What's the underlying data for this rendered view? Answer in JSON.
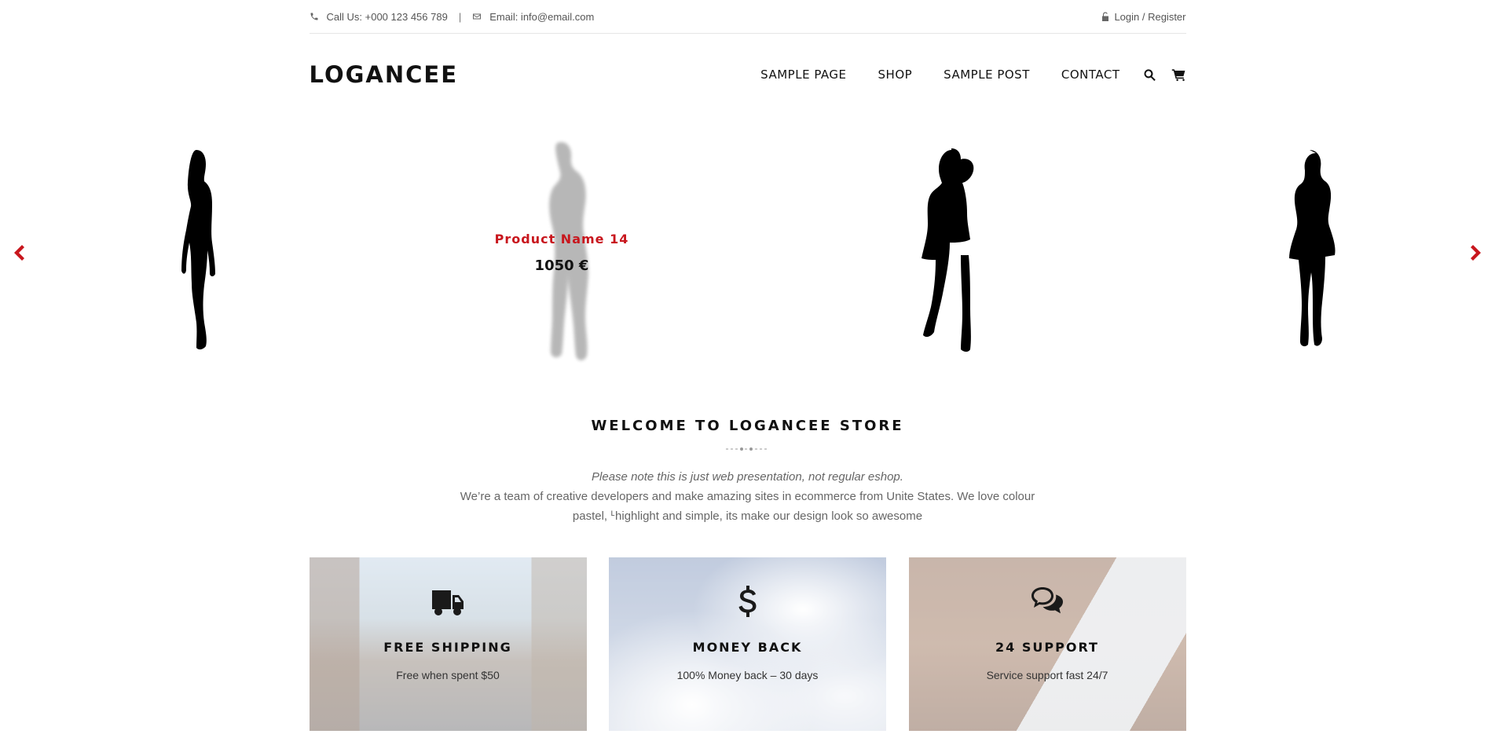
{
  "topbar": {
    "phone": "Call Us: +000 123 456 789",
    "separator": "|",
    "email": "Email: info@email.com",
    "login": "Login / Register"
  },
  "header": {
    "logo": "LOGANCEE",
    "nav": [
      "SAMPLE PAGE",
      "SHOP",
      "SAMPLE POST",
      "CONTACT"
    ]
  },
  "carousel": {
    "hover_product": {
      "name": "Product Name 14",
      "price": "1050 €"
    },
    "accent": "#c8161d"
  },
  "welcome": {
    "title": "WELCOME TO LOGANCEE STORE",
    "note": "Please note this is just web presentation, not regular eshop.",
    "description": "We’re a team of creative developers and make amazing sites in ecommerce from Unite States. We love colour pastel, ᒻhighlight and simple, its make our design look so awesome"
  },
  "features": [
    {
      "icon": "truck-icon",
      "title": "FREE SHIPPING",
      "text": "Free when spent $50"
    },
    {
      "icon": "dollar-icon",
      "title": "MONEY BACK",
      "text": "100% Money back – 30 days"
    },
    {
      "icon": "chat-bubbles-icon",
      "title": "24 SUPPORT",
      "text": "Service support fast 24/7"
    }
  ]
}
